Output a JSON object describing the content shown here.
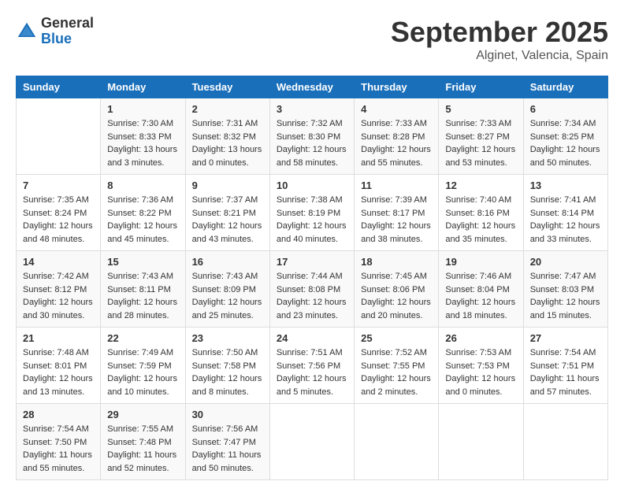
{
  "header": {
    "logo_general": "General",
    "logo_blue": "Blue",
    "month": "September 2025",
    "location": "Alginet, Valencia, Spain"
  },
  "weekdays": [
    "Sunday",
    "Monday",
    "Tuesday",
    "Wednesday",
    "Thursday",
    "Friday",
    "Saturday"
  ],
  "weeks": [
    [
      {
        "day": "",
        "sunrise": "",
        "sunset": "",
        "daylight": ""
      },
      {
        "day": "1",
        "sunrise": "Sunrise: 7:30 AM",
        "sunset": "Sunset: 8:33 PM",
        "daylight": "Daylight: 13 hours and 3 minutes."
      },
      {
        "day": "2",
        "sunrise": "Sunrise: 7:31 AM",
        "sunset": "Sunset: 8:32 PM",
        "daylight": "Daylight: 13 hours and 0 minutes."
      },
      {
        "day": "3",
        "sunrise": "Sunrise: 7:32 AM",
        "sunset": "Sunset: 8:30 PM",
        "daylight": "Daylight: 12 hours and 58 minutes."
      },
      {
        "day": "4",
        "sunrise": "Sunrise: 7:33 AM",
        "sunset": "Sunset: 8:28 PM",
        "daylight": "Daylight: 12 hours and 55 minutes."
      },
      {
        "day": "5",
        "sunrise": "Sunrise: 7:33 AM",
        "sunset": "Sunset: 8:27 PM",
        "daylight": "Daylight: 12 hours and 53 minutes."
      },
      {
        "day": "6",
        "sunrise": "Sunrise: 7:34 AM",
        "sunset": "Sunset: 8:25 PM",
        "daylight": "Daylight: 12 hours and 50 minutes."
      }
    ],
    [
      {
        "day": "7",
        "sunrise": "Sunrise: 7:35 AM",
        "sunset": "Sunset: 8:24 PM",
        "daylight": "Daylight: 12 hours and 48 minutes."
      },
      {
        "day": "8",
        "sunrise": "Sunrise: 7:36 AM",
        "sunset": "Sunset: 8:22 PM",
        "daylight": "Daylight: 12 hours and 45 minutes."
      },
      {
        "day": "9",
        "sunrise": "Sunrise: 7:37 AM",
        "sunset": "Sunset: 8:21 PM",
        "daylight": "Daylight: 12 hours and 43 minutes."
      },
      {
        "day": "10",
        "sunrise": "Sunrise: 7:38 AM",
        "sunset": "Sunset: 8:19 PM",
        "daylight": "Daylight: 12 hours and 40 minutes."
      },
      {
        "day": "11",
        "sunrise": "Sunrise: 7:39 AM",
        "sunset": "Sunset: 8:17 PM",
        "daylight": "Daylight: 12 hours and 38 minutes."
      },
      {
        "day": "12",
        "sunrise": "Sunrise: 7:40 AM",
        "sunset": "Sunset: 8:16 PM",
        "daylight": "Daylight: 12 hours and 35 minutes."
      },
      {
        "day": "13",
        "sunrise": "Sunrise: 7:41 AM",
        "sunset": "Sunset: 8:14 PM",
        "daylight": "Daylight: 12 hours and 33 minutes."
      }
    ],
    [
      {
        "day": "14",
        "sunrise": "Sunrise: 7:42 AM",
        "sunset": "Sunset: 8:12 PM",
        "daylight": "Daylight: 12 hours and 30 minutes."
      },
      {
        "day": "15",
        "sunrise": "Sunrise: 7:43 AM",
        "sunset": "Sunset: 8:11 PM",
        "daylight": "Daylight: 12 hours and 28 minutes."
      },
      {
        "day": "16",
        "sunrise": "Sunrise: 7:43 AM",
        "sunset": "Sunset: 8:09 PM",
        "daylight": "Daylight: 12 hours and 25 minutes."
      },
      {
        "day": "17",
        "sunrise": "Sunrise: 7:44 AM",
        "sunset": "Sunset: 8:08 PM",
        "daylight": "Daylight: 12 hours and 23 minutes."
      },
      {
        "day": "18",
        "sunrise": "Sunrise: 7:45 AM",
        "sunset": "Sunset: 8:06 PM",
        "daylight": "Daylight: 12 hours and 20 minutes."
      },
      {
        "day": "19",
        "sunrise": "Sunrise: 7:46 AM",
        "sunset": "Sunset: 8:04 PM",
        "daylight": "Daylight: 12 hours and 18 minutes."
      },
      {
        "day": "20",
        "sunrise": "Sunrise: 7:47 AM",
        "sunset": "Sunset: 8:03 PM",
        "daylight": "Daylight: 12 hours and 15 minutes."
      }
    ],
    [
      {
        "day": "21",
        "sunrise": "Sunrise: 7:48 AM",
        "sunset": "Sunset: 8:01 PM",
        "daylight": "Daylight: 12 hours and 13 minutes."
      },
      {
        "day": "22",
        "sunrise": "Sunrise: 7:49 AM",
        "sunset": "Sunset: 7:59 PM",
        "daylight": "Daylight: 12 hours and 10 minutes."
      },
      {
        "day": "23",
        "sunrise": "Sunrise: 7:50 AM",
        "sunset": "Sunset: 7:58 PM",
        "daylight": "Daylight: 12 hours and 8 minutes."
      },
      {
        "day": "24",
        "sunrise": "Sunrise: 7:51 AM",
        "sunset": "Sunset: 7:56 PM",
        "daylight": "Daylight: 12 hours and 5 minutes."
      },
      {
        "day": "25",
        "sunrise": "Sunrise: 7:52 AM",
        "sunset": "Sunset: 7:55 PM",
        "daylight": "Daylight: 12 hours and 2 minutes."
      },
      {
        "day": "26",
        "sunrise": "Sunrise: 7:53 AM",
        "sunset": "Sunset: 7:53 PM",
        "daylight": "Daylight: 12 hours and 0 minutes."
      },
      {
        "day": "27",
        "sunrise": "Sunrise: 7:54 AM",
        "sunset": "Sunset: 7:51 PM",
        "daylight": "Daylight: 11 hours and 57 minutes."
      }
    ],
    [
      {
        "day": "28",
        "sunrise": "Sunrise: 7:54 AM",
        "sunset": "Sunset: 7:50 PM",
        "daylight": "Daylight: 11 hours and 55 minutes."
      },
      {
        "day": "29",
        "sunrise": "Sunrise: 7:55 AM",
        "sunset": "Sunset: 7:48 PM",
        "daylight": "Daylight: 11 hours and 52 minutes."
      },
      {
        "day": "30",
        "sunrise": "Sunrise: 7:56 AM",
        "sunset": "Sunset: 7:47 PM",
        "daylight": "Daylight: 11 hours and 50 minutes."
      },
      {
        "day": "",
        "sunrise": "",
        "sunset": "",
        "daylight": ""
      },
      {
        "day": "",
        "sunrise": "",
        "sunset": "",
        "daylight": ""
      },
      {
        "day": "",
        "sunrise": "",
        "sunset": "",
        "daylight": ""
      },
      {
        "day": "",
        "sunrise": "",
        "sunset": "",
        "daylight": ""
      }
    ]
  ]
}
